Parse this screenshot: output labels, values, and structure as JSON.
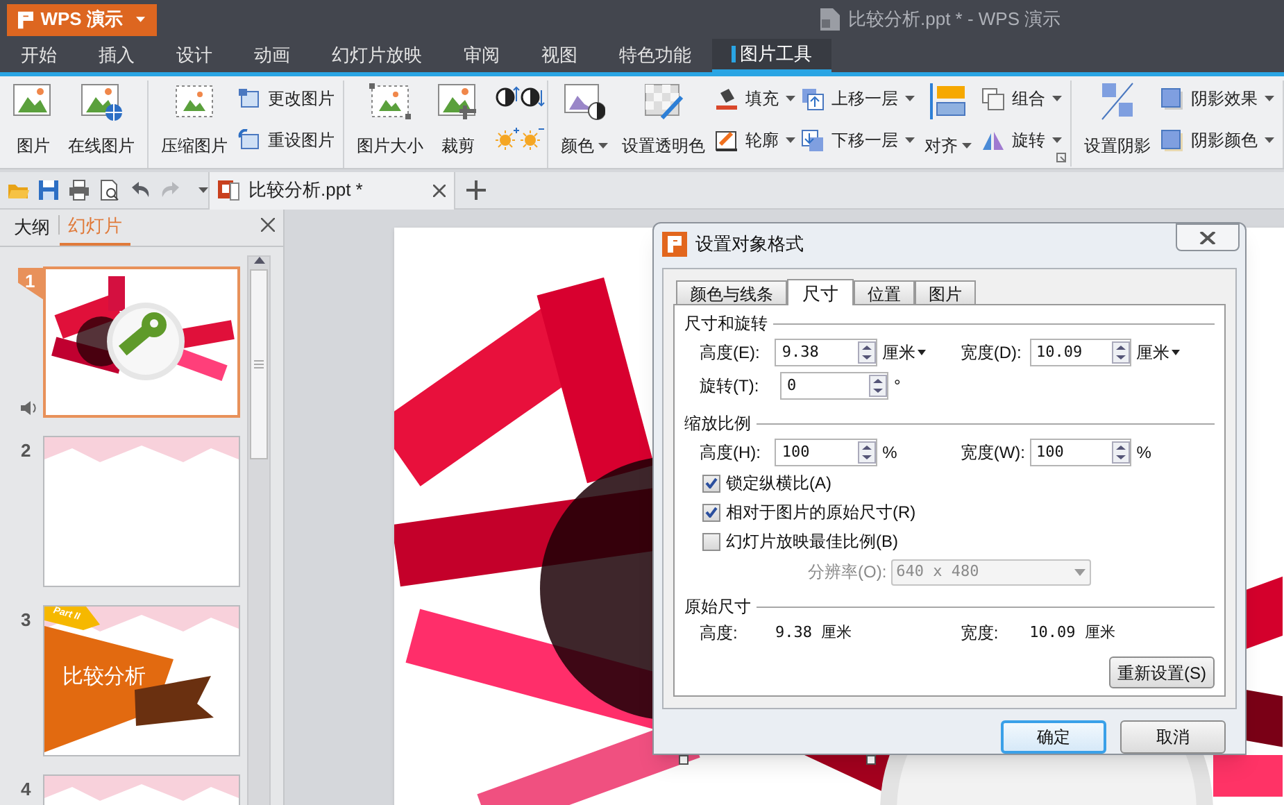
{
  "app_button": {
    "label": "WPS 演示"
  },
  "window": {
    "title": "比较分析.ppt * - WPS 演示"
  },
  "menu_tabs": [
    {
      "label": "开始",
      "selected": false
    },
    {
      "label": "插入",
      "selected": false
    },
    {
      "label": "设计",
      "selected": false
    },
    {
      "label": "动画",
      "selected": false
    },
    {
      "label": "幻灯片放映",
      "selected": false
    },
    {
      "label": "审阅",
      "selected": false
    },
    {
      "label": "视图",
      "selected": false
    },
    {
      "label": "特色功能",
      "selected": false
    },
    {
      "label": "图片工具",
      "selected": true
    }
  ],
  "ribbon": {
    "groups": [
      {
        "launcher": false,
        "items": [
          {
            "kind": "large",
            "label": "图片",
            "dropdown": false
          },
          {
            "kind": "large",
            "label": "在线图片",
            "dropdown": false
          }
        ]
      },
      {
        "launcher": false,
        "items": [
          {
            "kind": "large",
            "label": "压缩图片",
            "dropdown": false
          },
          {
            "kind": "small",
            "label": "更改图片",
            "dropdown": false
          },
          {
            "kind": "small",
            "label": "重设图片",
            "dropdown": false
          }
        ]
      },
      {
        "launcher": false,
        "items": [
          {
            "kind": "large",
            "label": "图片大小",
            "dropdown": false
          },
          {
            "kind": "large",
            "label": "裁剪",
            "dropdown": false
          },
          {
            "kind": "tiny"
          },
          {
            "kind": "tiny"
          },
          {
            "kind": "tiny"
          },
          {
            "kind": "tiny"
          }
        ]
      },
      {
        "launcher": true,
        "items": [
          {
            "kind": "large",
            "label": "颜色",
            "dropdown": true
          },
          {
            "kind": "large",
            "label": "设置透明色",
            "dropdown": false
          },
          {
            "kind": "small",
            "label": "填充",
            "dropdown": true
          },
          {
            "kind": "small",
            "label": "轮廓",
            "dropdown": true
          },
          {
            "kind": "small",
            "label": "上移一层",
            "dropdown": true
          },
          {
            "kind": "small",
            "label": "下移一层",
            "dropdown": true
          },
          {
            "kind": "large",
            "label": "对齐",
            "dropdown": true
          },
          {
            "kind": "small",
            "label": "组合",
            "dropdown": true
          },
          {
            "kind": "small",
            "label": "旋转",
            "dropdown": true
          }
        ]
      },
      {
        "launcher": false,
        "items": [
          {
            "kind": "large",
            "label": "设置阴影",
            "dropdown": false
          },
          {
            "kind": "small",
            "label": "阴影效果",
            "dropdown": true
          },
          {
            "kind": "small",
            "label": "阴影颜色",
            "dropdown": true
          }
        ]
      }
    ]
  },
  "doc_tab": {
    "label": "比较分析.ppt *"
  },
  "side_panel": {
    "tabs": [
      {
        "label": "大纲",
        "selected": false
      },
      {
        "label": "幻灯片",
        "selected": true
      }
    ],
    "slides": [
      {
        "number": "1",
        "selected": true,
        "sound": true,
        "kind": "picture"
      },
      {
        "number": "2",
        "selected": false,
        "sound": false,
        "kind": "blank"
      },
      {
        "number": "3",
        "selected": false,
        "sound": false,
        "kind": "title",
        "tag": "Part II",
        "title": "比较分析"
      },
      {
        "number": "4",
        "selected": false,
        "kind": "blank"
      }
    ]
  },
  "dialog": {
    "title": "设置对象格式",
    "tabs": [
      {
        "label": "颜色与线条",
        "selected": false
      },
      {
        "label": "尺寸",
        "selected": true
      },
      {
        "label": "位置",
        "selected": false
      },
      {
        "label": "图片",
        "selected": false
      }
    ],
    "size_rotate": {
      "heading": "尺寸和旋转",
      "rows": [
        [
          {
            "label": "高度(E):",
            "value": "9.38",
            "unit": "厘米",
            "dropdown": true
          },
          {
            "label": "宽度(D):",
            "value": "10.09",
            "unit": "厘米",
            "dropdown": true
          }
        ],
        [
          {
            "label": "旋转(T):",
            "value": "0",
            "unit": "°",
            "dropdown": false
          }
        ]
      ]
    },
    "scale": {
      "heading": "缩放比例",
      "rows": [
        [
          {
            "label": "高度(H):",
            "value": "100",
            "unit": "%",
            "dropdown": false
          },
          {
            "label": "宽度(W):",
            "value": "100",
            "unit": "%",
            "dropdown": false
          }
        ]
      ],
      "checkboxes": [
        {
          "label": "锁定纵横比(A)",
          "checked": true
        },
        {
          "label": "相对于图片的原始尺寸(R)",
          "checked": true
        },
        {
          "label": "幻灯片放映最佳比例(B)",
          "checked": false
        }
      ],
      "resolution": {
        "label": "分辨率(O):",
        "value": "640 x 480",
        "disabled": true
      }
    },
    "original": {
      "heading": "原始尺寸",
      "items": [
        {
          "label": "高度:",
          "value": "9.38 厘米"
        },
        {
          "label": "宽度:",
          "value": "10.09 厘米"
        }
      ]
    },
    "reset_button": {
      "label": "重新设置(S)"
    },
    "buttons": [
      {
        "label": "确定",
        "default": true
      },
      {
        "label": "取消",
        "default": false
      }
    ]
  }
}
